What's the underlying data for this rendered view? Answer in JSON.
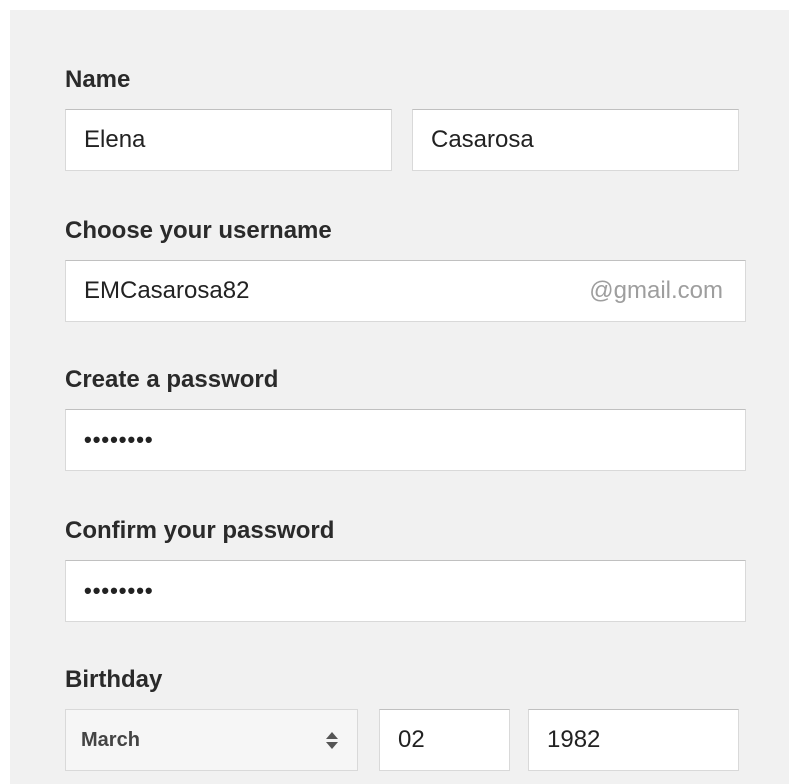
{
  "form": {
    "name": {
      "label": "Name",
      "first_value": "Elena",
      "last_value": "Casarosa"
    },
    "username": {
      "label": "Choose your username",
      "value": "EMCasarosa82",
      "suffix": "@gmail.com"
    },
    "password": {
      "label": "Create a password",
      "value": "••••••••"
    },
    "confirm_password": {
      "label": "Confirm your password",
      "value": "••••••••"
    },
    "birthday": {
      "label": "Birthday",
      "month": "March",
      "day": "02",
      "year": "1982"
    }
  },
  "icons": {
    "month_select_arrows": "up-down-chevron-icon"
  }
}
